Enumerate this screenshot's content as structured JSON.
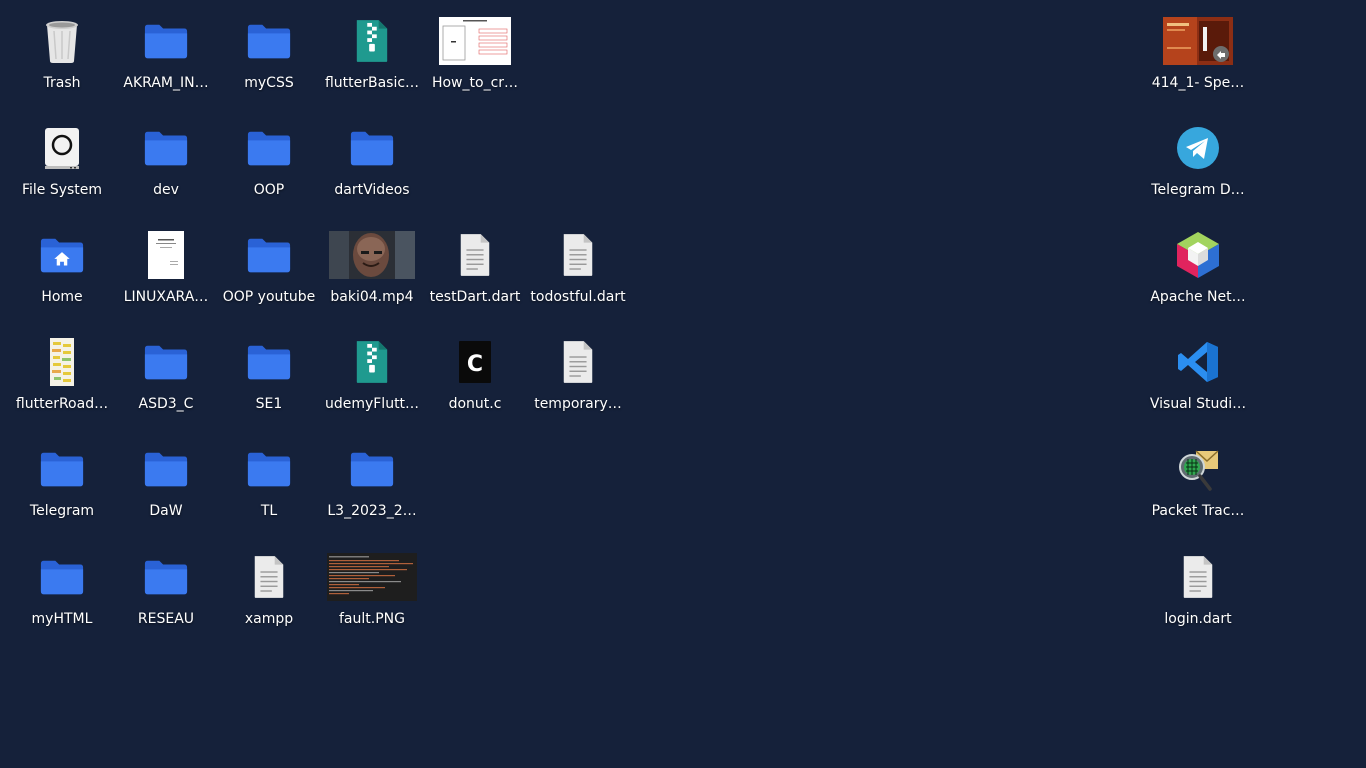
{
  "desktop": {
    "background": "#15213a",
    "icons": {
      "trash": {
        "label": "Trash",
        "icon": "trash-icon"
      },
      "filesystem": {
        "label": "File System",
        "icon": "drive-icon"
      },
      "home": {
        "label": "Home",
        "icon": "home-folder-icon"
      },
      "flutterroad": {
        "label": "flutterRoad…",
        "icon": "image-thumbnail-icon"
      },
      "telegram_folder": {
        "label": "Telegram",
        "icon": "folder-icon"
      },
      "myhtml": {
        "label": "myHTML",
        "icon": "folder-icon"
      },
      "akram": {
        "label": "AKRAM_IN…",
        "icon": "folder-icon"
      },
      "dev": {
        "label": "dev",
        "icon": "folder-icon"
      },
      "linuxara": {
        "label": "LINUXARA…",
        "icon": "document-thumbnail-icon"
      },
      "asd3": {
        "label": "ASD3_C",
        "icon": "folder-icon"
      },
      "daw": {
        "label": "DaW",
        "icon": "folder-icon"
      },
      "reseau": {
        "label": "RESEAU",
        "icon": "folder-icon"
      },
      "mycss": {
        "label": "myCSS",
        "icon": "folder-icon"
      },
      "oop": {
        "label": "OOP",
        "icon": "folder-icon"
      },
      "oop_youtube": {
        "label": "OOP youtube",
        "icon": "folder-icon"
      },
      "se1": {
        "label": "SE1",
        "icon": "folder-icon"
      },
      "tl": {
        "label": "TL",
        "icon": "folder-icon"
      },
      "xampp": {
        "label": "xampp",
        "icon": "text-file-icon"
      },
      "flutterbasic": {
        "label": "flutterBasic…",
        "icon": "zip-archive-icon"
      },
      "dartvideos": {
        "label": "dartVideos",
        "icon": "folder-icon"
      },
      "baki": {
        "label": "baki04.mp4",
        "icon": "video-thumbnail-icon"
      },
      "udemyflutter": {
        "label": "udemyFlutt…",
        "icon": "zip-archive-icon"
      },
      "l3": {
        "label": "L3_2023_2…",
        "icon": "folder-icon"
      },
      "fault": {
        "label": "fault.PNG",
        "icon": "image-thumbnail-icon"
      },
      "howto": {
        "label": "How_to_cr…",
        "icon": "image-thumbnail-icon"
      },
      "testdart": {
        "label": "testDart.dart",
        "icon": "text-file-icon"
      },
      "donut": {
        "label": "donut.c",
        "icon": "c-source-icon"
      },
      "todostful": {
        "label": "todostful.dart",
        "icon": "text-file-icon"
      },
      "temporary": {
        "label": "temporary…",
        "icon": "text-file-icon"
      },
      "speak": {
        "label": "414_1- Spe…",
        "icon": "book-cover-icon"
      },
      "telegram_desktop": {
        "label": "Telegram D…",
        "icon": "telegram-icon"
      },
      "netbeans": {
        "label": "Apache Net…",
        "icon": "netbeans-icon"
      },
      "vscode": {
        "label": "Visual Studi…",
        "icon": "vscode-icon"
      },
      "packet": {
        "label": "Packet Trac…",
        "icon": "packet-tracer-icon"
      },
      "login": {
        "label": "login.dart",
        "icon": "text-file-icon"
      }
    }
  }
}
